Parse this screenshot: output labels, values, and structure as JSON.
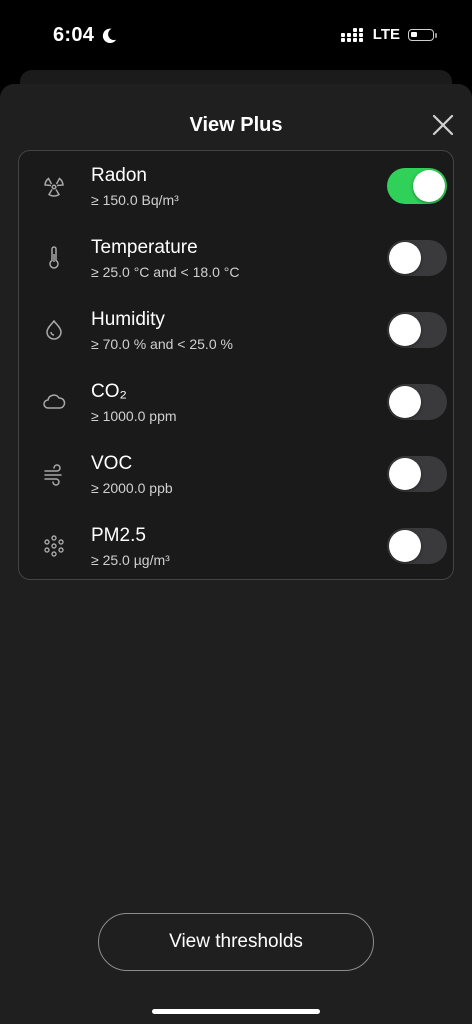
{
  "status_bar": {
    "time": "6:04",
    "network": "LTE"
  },
  "sheet": {
    "title": "View Plus"
  },
  "items": [
    {
      "name": "Radon",
      "threshold": "≥ 150.0 Bq/m³",
      "icon": "radiation-icon",
      "enabled": true
    },
    {
      "name": "Temperature",
      "threshold": "≥ 25.0 °C and < 18.0 °C",
      "icon": "thermometer-icon",
      "enabled": false
    },
    {
      "name": "Humidity",
      "threshold": "≥ 70.0 % and < 25.0 %",
      "icon": "droplet-icon",
      "enabled": false
    },
    {
      "name": "CO₂",
      "threshold": "≥ 1000.0 ppm",
      "icon": "cloud-icon",
      "enabled": false
    },
    {
      "name": "VOC",
      "threshold": "≥ 2000.0 ppb",
      "icon": "wind-icon",
      "enabled": false
    },
    {
      "name": "PM2.5",
      "threshold": "≥ 25.0 µg/m³",
      "icon": "particles-icon",
      "enabled": false
    }
  ],
  "footer": {
    "button_label": "View thresholds"
  },
  "colors": {
    "toggle_on": "#30d158",
    "toggle_off": "#3a3a3c"
  }
}
